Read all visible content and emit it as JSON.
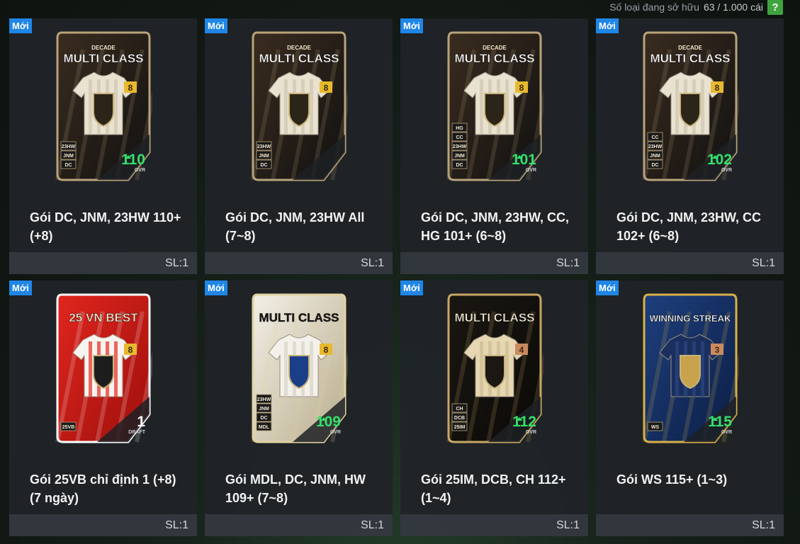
{
  "header": {
    "owned_label": "Số loại đang sở hữu",
    "owned_count": "63 / 1.000 cái",
    "help_label": "?"
  },
  "packs": [
    {
      "badge": "Mới",
      "name": "Gói DC, JNM, 23HW 110+ (+8)",
      "quantity": "SL:1",
      "card_top": "DECADE",
      "card_title": "MULTI CLASS",
      "grade": "8",
      "rating": "110",
      "rating_label": "OVR",
      "tags": [
        "23HW",
        "JNM",
        "DC"
      ],
      "style": "decade"
    },
    {
      "badge": "Mới",
      "name": "Gói DC, JNM, 23HW All (7~8)",
      "quantity": "SL:1",
      "card_top": "DECADE",
      "card_title": "MULTI CLASS",
      "grade": "8",
      "rating": "",
      "rating_label": "",
      "tags": [
        "23HW",
        "JNM",
        "DC"
      ],
      "style": "decade"
    },
    {
      "badge": "Mới",
      "name": "Gói DC, JNM, 23HW, CC, HG 101+ (6~8)",
      "quantity": "SL:1",
      "card_top": "DECADE",
      "card_title": "MULTI CLASS",
      "grade": "8",
      "rating": "101",
      "rating_label": "OVR",
      "tags": [
        "HG",
        "CC",
        "23HW",
        "JNM",
        "DC"
      ],
      "style": "decade"
    },
    {
      "badge": "Mới",
      "name": "Gói DC, JNM, 23HW, CC 102+ (6~8)",
      "quantity": "SL:1",
      "card_top": "DECADE",
      "card_title": "MULTI CLASS",
      "grade": "8",
      "rating": "102",
      "rating_label": "OVR",
      "tags": [
        "CC",
        "23HW",
        "JNM",
        "DC"
      ],
      "style": "decade"
    },
    {
      "badge": "Mới",
      "name": "Gói 25VB chỉ định 1 (+8) (7 ngày)",
      "quantity": "SL:1",
      "card_top": "",
      "card_title": "25 VN BEST",
      "grade": "8",
      "rating": "1",
      "rating_label": "DRAFT",
      "tags": [
        "25VB"
      ],
      "style": "vnbest"
    },
    {
      "badge": "Mới",
      "name": "Gói MDL, DC, JNM, HW 109+ (7~8)",
      "quantity": "SL:1",
      "card_top": "",
      "card_title": "MULTI CLASS",
      "grade": "8",
      "rating": "109",
      "rating_label": "OVR",
      "tags": [
        "23HW",
        "JNM",
        "DC",
        "MDL"
      ],
      "style": "mdl"
    },
    {
      "badge": "Mới",
      "name": "Gói 25IM, DCB, CH 112+ (1~4)",
      "quantity": "SL:1",
      "card_top": "",
      "card_title": "MULTI CLASS",
      "grade": "4",
      "rating": "112",
      "rating_label": "OVR",
      "tags": [
        "CH",
        "DCB",
        "25IM"
      ],
      "style": "im"
    },
    {
      "badge": "Mới",
      "name": "Gói WS 115+ (1~3)",
      "quantity": "SL:1",
      "card_top": "",
      "card_title": "WINNING STREAK",
      "grade": "3",
      "rating": "115",
      "rating_label": "OVR",
      "tags": [
        "WS"
      ],
      "style": "ws"
    }
  ],
  "colors": {
    "new_badge": "#1f86e6",
    "rating_green": "#34e06a",
    "help_green": "#3fa33f"
  }
}
